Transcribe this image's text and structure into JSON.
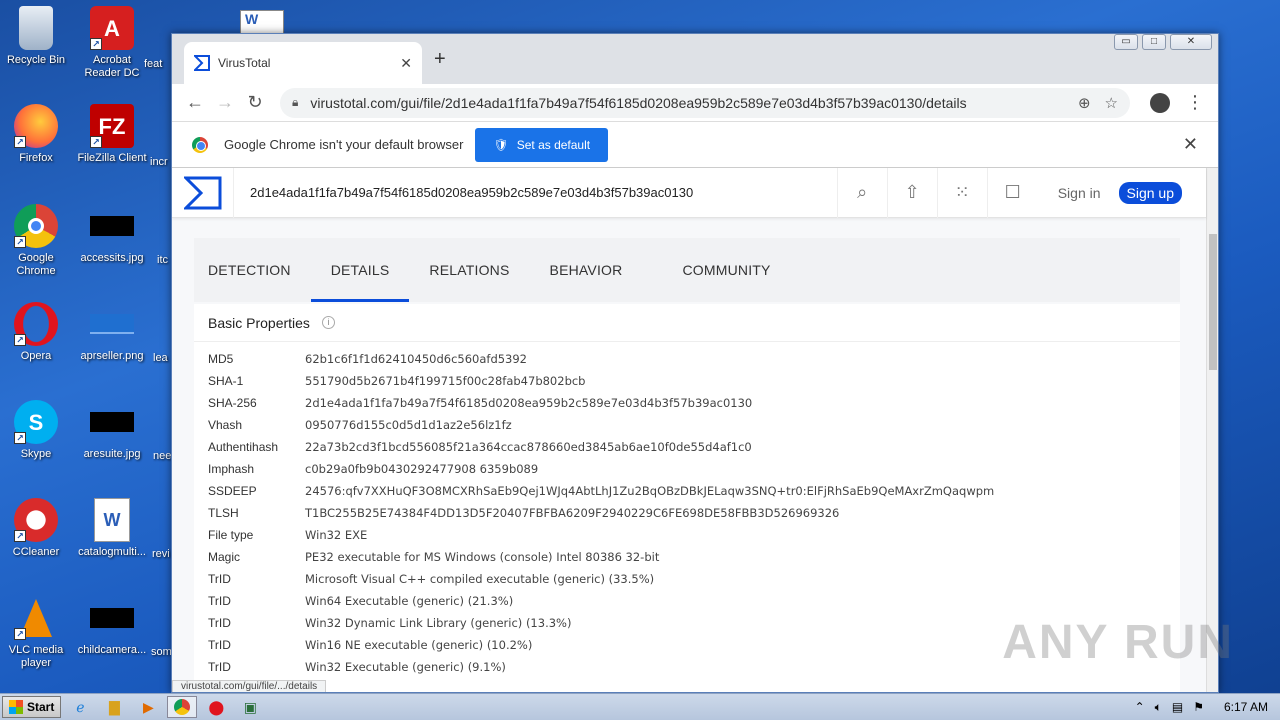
{
  "desktop": {
    "icons": [
      {
        "label": "Recycle Bin"
      },
      {
        "label": "Acrobat Reader DC"
      },
      {
        "label": "Firefox"
      },
      {
        "label": "FileZilla Client"
      },
      {
        "label": "Google Chrome"
      },
      {
        "label": "accessits.jpg"
      },
      {
        "label": "Opera"
      },
      {
        "label": "aprseller.png"
      },
      {
        "label": "Skype"
      },
      {
        "label": "aresuite.jpg"
      },
      {
        "label": "CCleaner"
      },
      {
        "label": "catalogmulti..."
      },
      {
        "label": "VLC media player"
      },
      {
        "label": "childcamera..."
      }
    ],
    "partial_labels": [
      "feat",
      "incr",
      "itc",
      "lea",
      "nee",
      "revi",
      "som"
    ]
  },
  "browser": {
    "tab_title": "VirusTotal",
    "tab_close": "✕",
    "new_tab": "+",
    "window_controls": [
      "▭",
      "□",
      "✕"
    ],
    "url": "virustotal.com/gui/file/2d1e4ada1f1fa7b49a7f54f6185d0208ea959b2c589e7e03d4b3f57b39ac0130/details",
    "infobar_message": "Google Chrome isn't your default browser",
    "set_default_label": "Set as default",
    "status_url": "virustotal.com/gui/file/.../details"
  },
  "virustotal": {
    "search_value": "2d1e4ada1f1fa7b49a7f54f6185d0208ea959b2c589e7e03d4b3f57b39ac0130",
    "sign_in": "Sign in",
    "sign_up": "Sign up",
    "tabs": [
      {
        "label": "DETECTION",
        "active": false
      },
      {
        "label": "DETAILS",
        "active": true
      },
      {
        "label": "RELATIONS",
        "active": false
      },
      {
        "label": "BEHAVIOR",
        "active": false
      },
      {
        "label": "COMMUNITY",
        "active": false
      }
    ],
    "section_title": "Basic Properties",
    "properties": [
      {
        "key": "MD5",
        "value": "62b1c6f1f1d62410450d6c560afd5392"
      },
      {
        "key": "SHA-1",
        "value": "551790d5b2671b4f199715f00c28fab47b802bcb"
      },
      {
        "key": "SHA-256",
        "value": "2d1e4ada1f1fa7b49a7f54f6185d0208ea959b2c589e7e03d4b3f57b39ac0130"
      },
      {
        "key": "Vhash",
        "value": "0950776d155c0d5d1d1az2e56lz1fz"
      },
      {
        "key": "Authentihash",
        "value": "22a73b2cd3f1bcd556085f21a364ccac878660ed3845ab6ae10f0de55d4af1c0"
      },
      {
        "key": "Imphash",
        "value": "c0b29a0fb9b0430292477908 6359b089"
      },
      {
        "key": "SSDEEP",
        "value": "24576:qfv7XXHuQF3O8MCXRhSaEb9Qej1WJq4AbtLhJ1Zu2BqOBzDBkJELaqw3SNQ+tr0:ElFjRhSaEb9QeMAxrZmQaqwpm"
      },
      {
        "key": "TLSH",
        "value": "T1BC255B25E74384F4DD13D5F20407FBFBA6209F2940229C6FE698DE58FBB3D526969326"
      },
      {
        "key": "File type",
        "value": "Win32 EXE"
      },
      {
        "key": "Magic",
        "value": "PE32 executable for MS Windows (console) Intel 80386 32-bit"
      },
      {
        "key": "TrID",
        "value": "Microsoft Visual C++ compiled executable (generic) (33.5%)"
      },
      {
        "key": "TrID",
        "value": "Win64 Executable (generic) (21.3%)"
      },
      {
        "key": "TrID",
        "value": "Win32 Dynamic Link Library (generic) (13.3%)"
      },
      {
        "key": "TrID",
        "value": "Win16 NE executable (generic) (10.2%)"
      },
      {
        "key": "TrID",
        "value": "Win32 Executable (generic) (9.1%)"
      }
    ]
  },
  "taskbar": {
    "start_label": "Start",
    "clock": "6:17 AM"
  },
  "watermark": "ANY RUN"
}
